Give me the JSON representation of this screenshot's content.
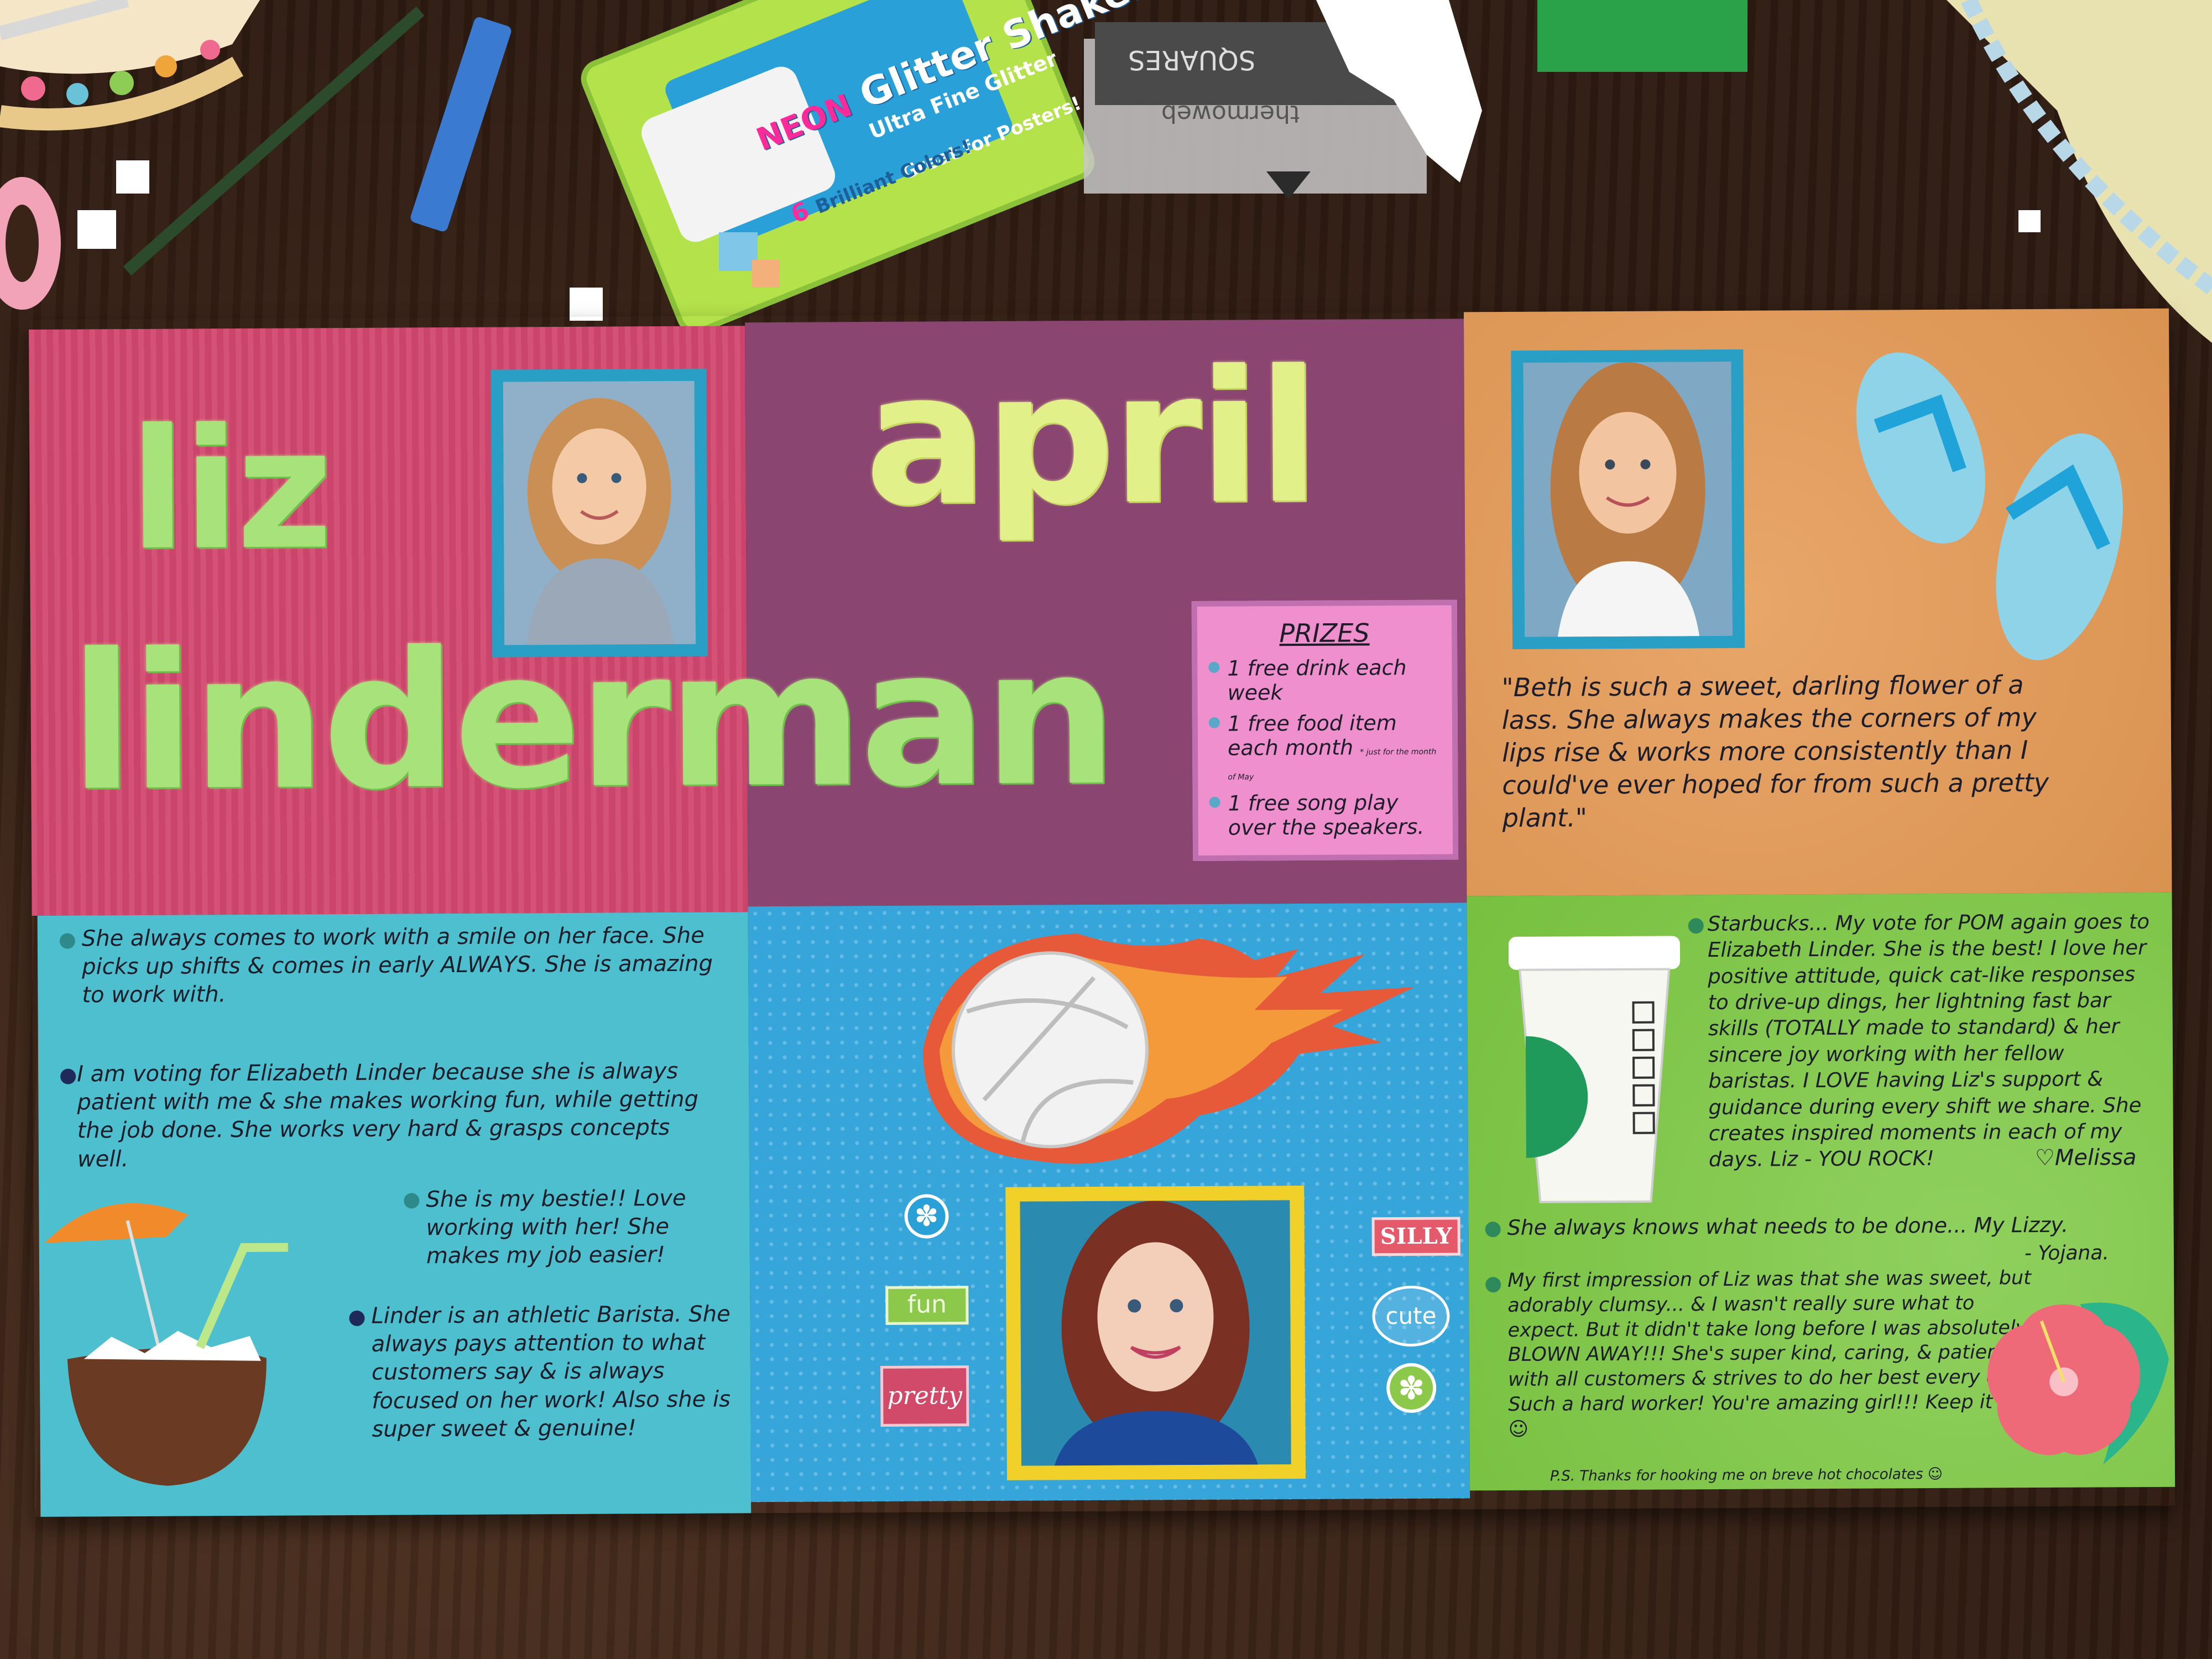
{
  "scene": {
    "title_first": "liz",
    "title_month": "april",
    "title_last": "linderman"
  },
  "clutter": {
    "glitter_pack_brand": "NEON",
    "glitter_pack_title": "Glitter Shakers",
    "glitter_pack_count": "6",
    "glitter_pack_colors": "Brilliant Colors!",
    "glitter_pack_fine": "Ultra Fine Glitter",
    "glitter_pack_posters": "Great for Posters!",
    "stamp_text": "SQUARES",
    "stamp_brand": "thermoweb"
  },
  "prizes": {
    "heading": "PRIZES",
    "items": [
      "1 free drink each week",
      "1 free food item each month",
      "1 free song play over the speakers."
    ],
    "footnote": "* just for the month of May"
  },
  "quote": "\"Beth is such a sweet, darling flower of a lass. She always makes the corners of my lips rise & works more consistently than I could've ever hoped for from such a pretty plant.\"",
  "notes_left": [
    "She always comes to work with a smile on her face. She picks up shifts & comes in early ALWAYS. She is amazing to work with.",
    "I am voting for Elizabeth Linder because she is always patient with me & she makes working fun, while getting the job done. She works very hard & grasps concepts well.",
    "She is my bestie!! Love working with her! She makes my job easier!",
    "Linder is an athletic Barista. She always pays attention to what customers say & is always focused on her work! Also she is super sweet & genuine!"
  ],
  "stickers": {
    "fun": "fun",
    "pretty": "pretty",
    "silly": "SILLY",
    "cute": "cute"
  },
  "notes_right": {
    "starbucks": "Starbucks... My vote for POM again goes to Elizabeth Linder. She is the best! I love her positive attitude, quick cat-like responses to drive-up dings, her lightning fast bar skills (TOTALLY made to standard) & her sincere joy working with her fellow baristas. I LOVE having Liz's support & guidance during every shift we share. She creates inspired moments in each of my days. Liz - YOU ROCK!",
    "starbucks_sign": "♡Melissa",
    "lizzy": "She always knows what needs to be done... My Lizzy.",
    "lizzy_sign": "- Yojana.",
    "impression": "My first impression of Liz was that she was sweet, but adorably clumsy... & I wasn't really sure what to expect. But it didn't take long before I was absolutely BLOWN AWAY!!! She's super kind, caring, & patient with all customers & strives to do her best every day! Such a hard worker! You're amazing girl!!! Keep it up! ☺",
    "ps": "P.S. Thanks for hooking me on breve hot chocolates ☺"
  },
  "colors": {
    "pink_panel": "#d2476f",
    "purple_panel": "#8a4570",
    "orange_panel": "#e59a55",
    "teal_panel": "#4ebfcf",
    "blue_panel": "#35a5da",
    "green_panel": "#7cc842",
    "title_green": "#a7e27b"
  }
}
